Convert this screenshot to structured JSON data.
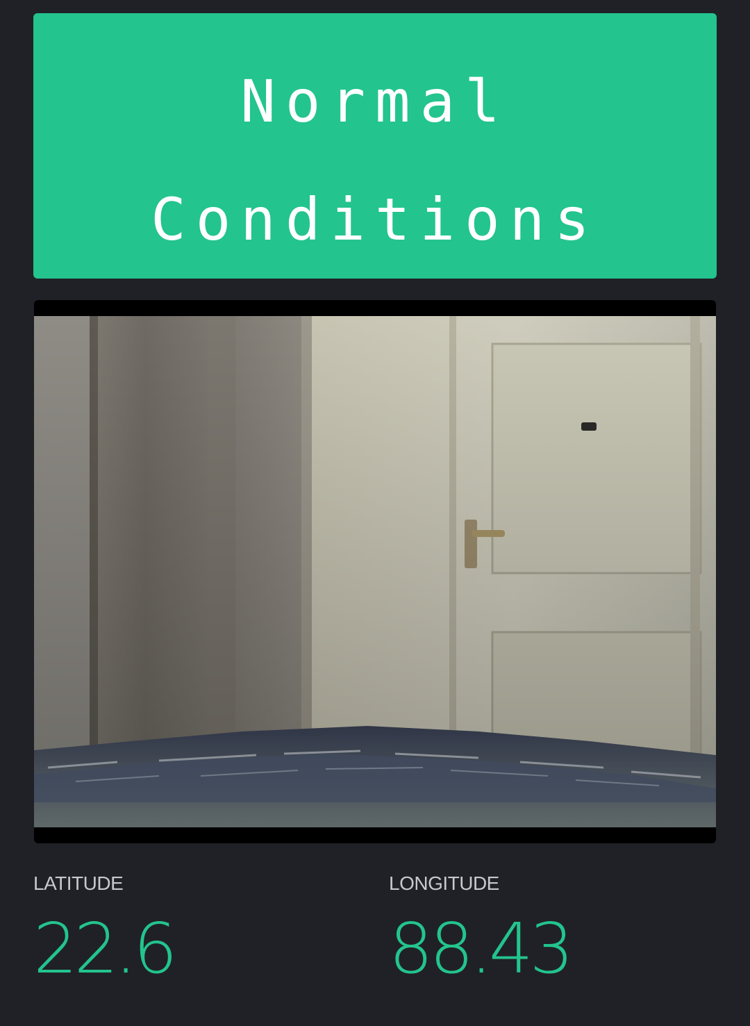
{
  "lcd": {
    "line1": "Normal",
    "line2": "Conditions",
    "background": "#23c48e",
    "text_color": "#ffffff"
  },
  "video": {
    "scene": "camera-stream"
  },
  "latitude": {
    "label": "LATITUDE",
    "value": "22.6"
  },
  "longitude": {
    "label": "LONGITUDE",
    "value": "88.43"
  },
  "colors": {
    "background": "#202126",
    "accent": "#23c48e",
    "label": "#c8c9cc"
  }
}
